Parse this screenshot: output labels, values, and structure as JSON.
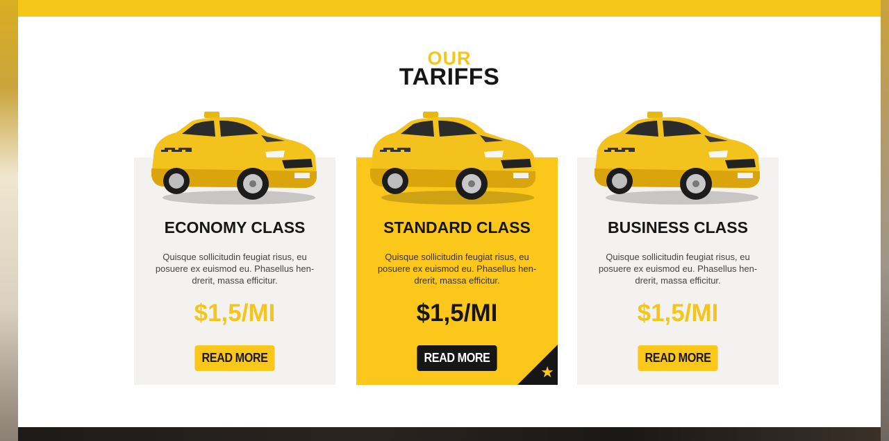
{
  "section": {
    "heading_top": "OUR",
    "heading_main": "TARIFFS"
  },
  "tariffs": [
    {
      "title": "ECONOMY CLASS",
      "description": "Quisque sollicitudin feugiat risus, eu posuere ex euismod eu. Phasellus hen-drerit, massa efficitur.",
      "price": "$1,5/MI",
      "button": "READ MORE"
    },
    {
      "title": "STANDARD CLASS",
      "description": "Quisque sollicitudin feugiat risus, eu posuere ex euismod eu. Phasellus hen-drerit, massa efficitur.",
      "price": "$1,5/MI",
      "button": "READ MORE"
    },
    {
      "title": "BUSINESS CLASS",
      "description": "Quisque sollicitudin feugiat risus, eu posuere ex euismod eu. Phasellus hen-drerit, massa efficitur.",
      "price": "$1,5/MI",
      "button": "READ MORE"
    }
  ],
  "colors": {
    "accent": "#f6c519",
    "dark": "#161616",
    "card_bg": "#f3f2f0"
  },
  "icons": {
    "featured_badge": "star-icon",
    "card_image": "taxi-car-icon"
  }
}
